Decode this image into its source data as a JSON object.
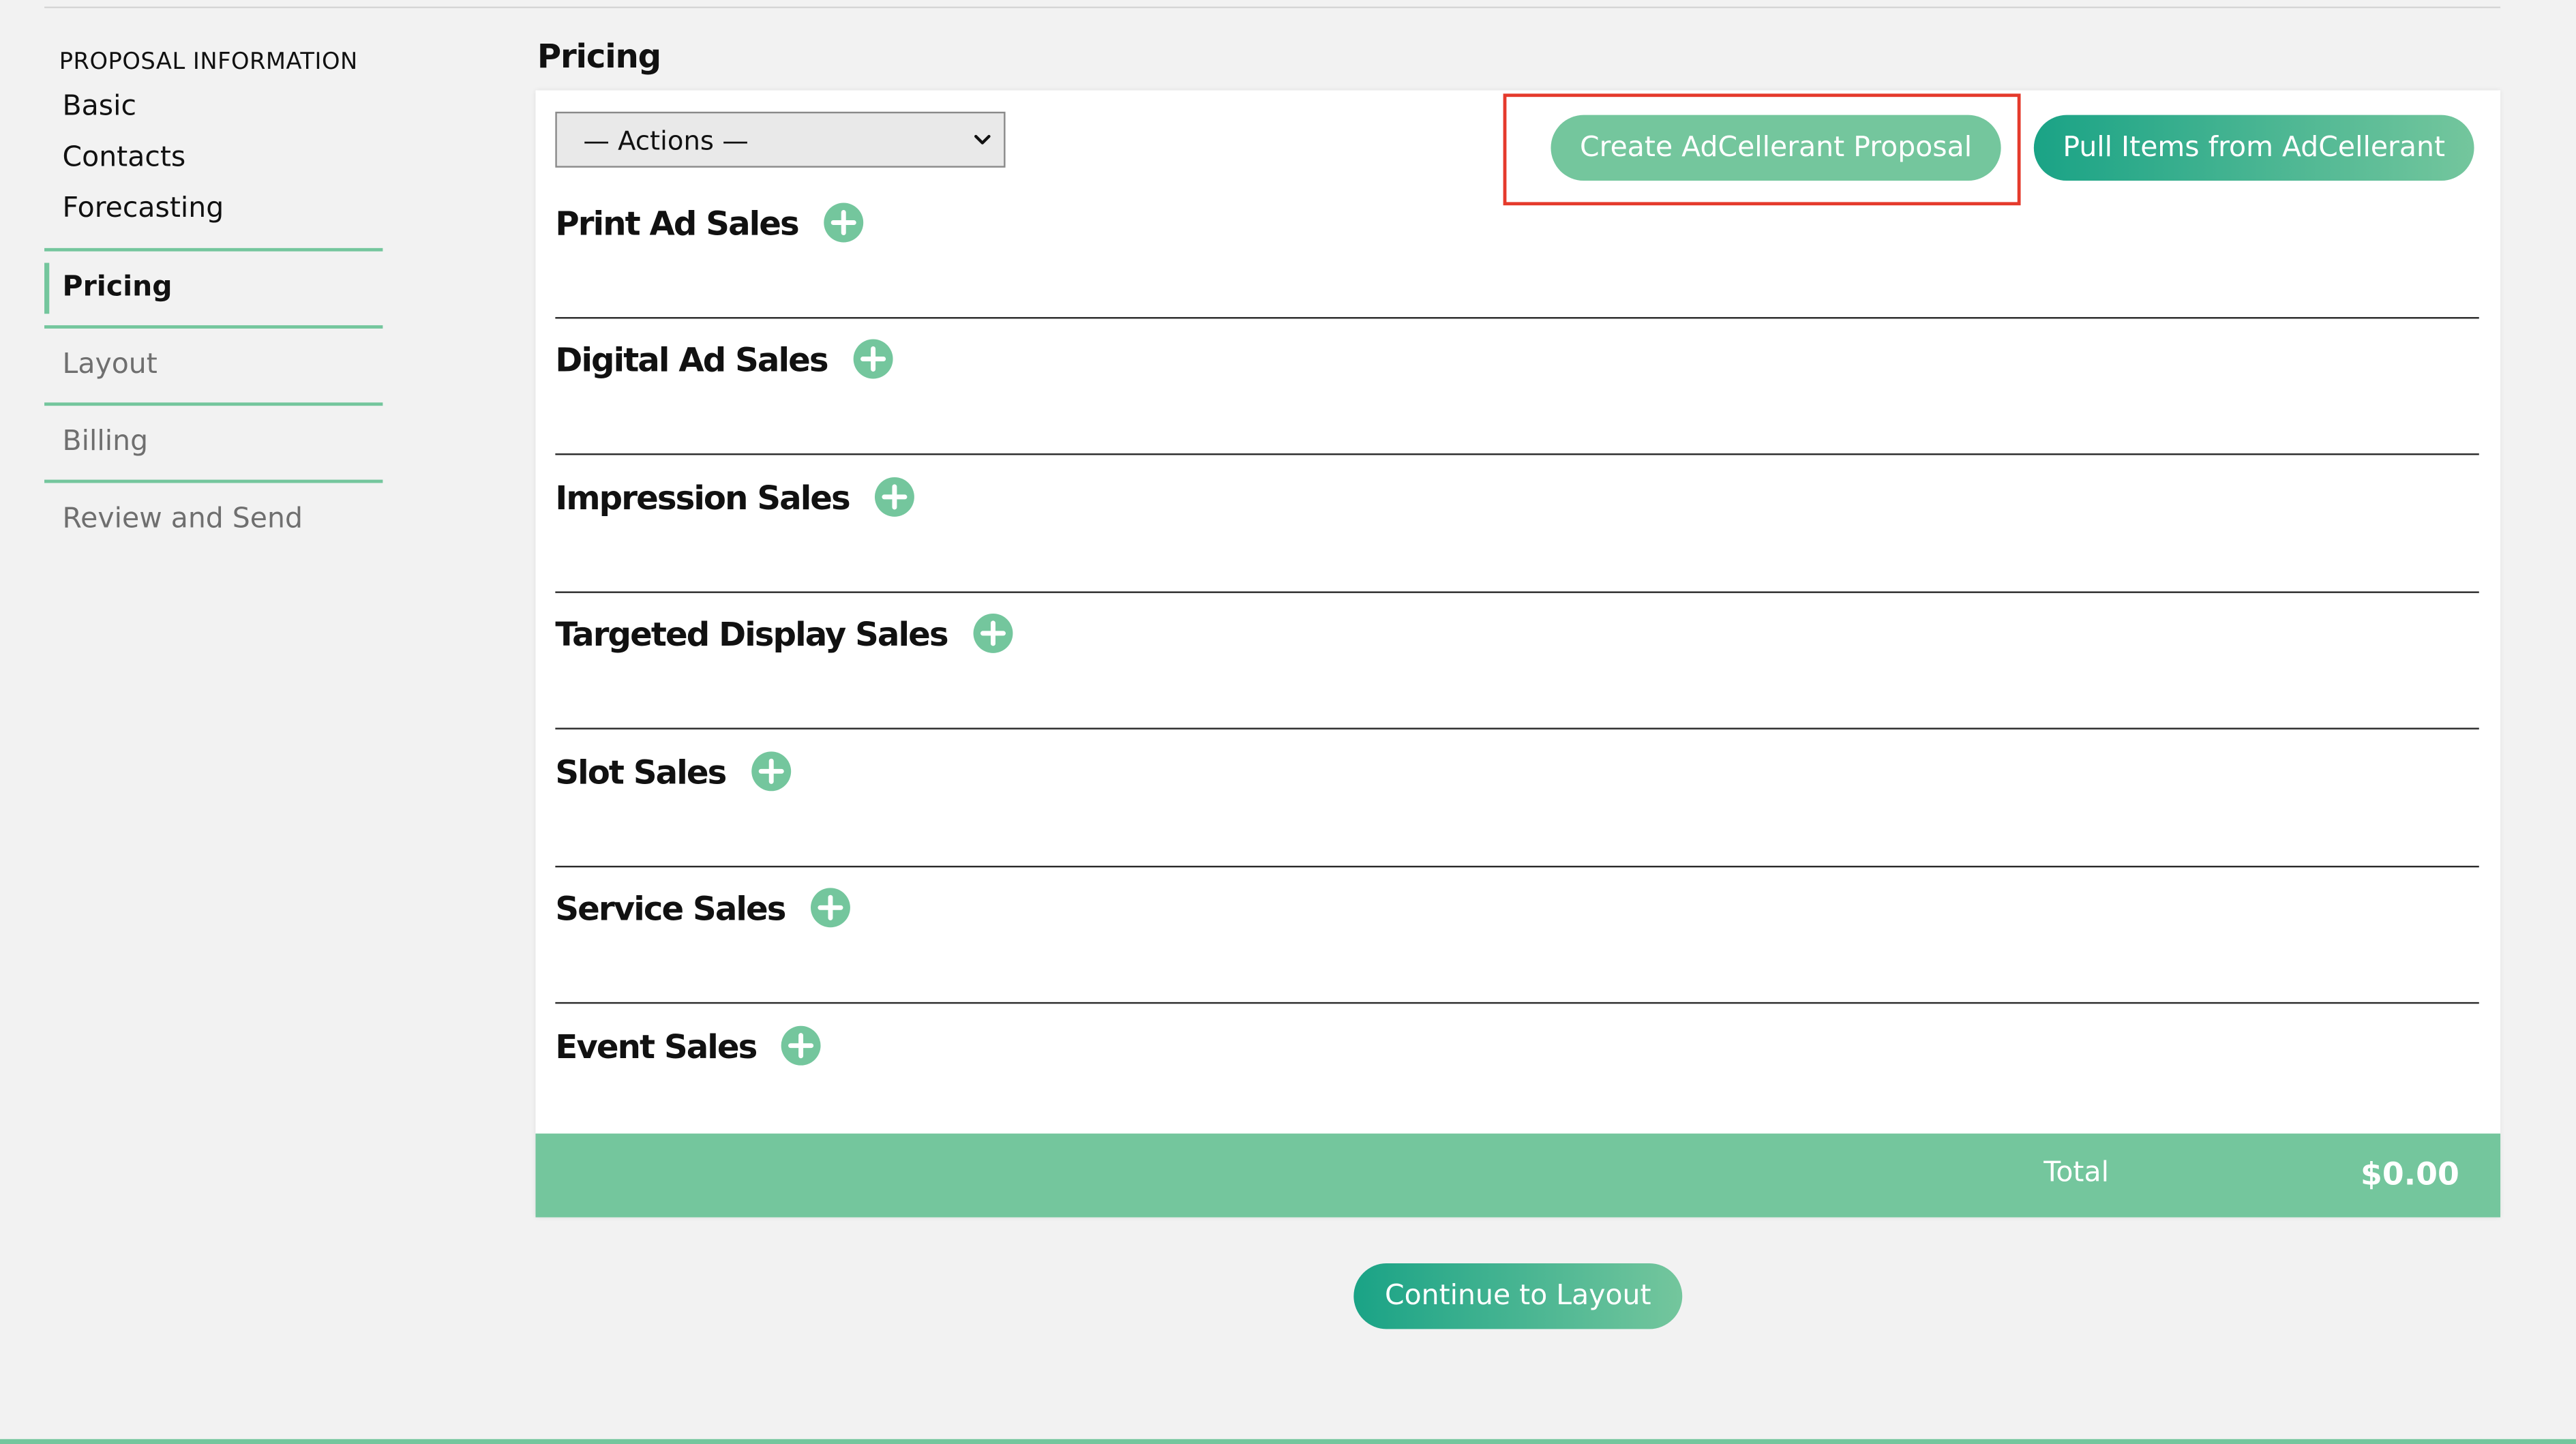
{
  "sidebar": {
    "header": "PROPOSAL INFORMATION",
    "sub_items": [
      "Basic",
      "Contacts",
      "Forecasting"
    ],
    "nav_items": [
      {
        "label": "Pricing",
        "active": true
      },
      {
        "label": "Layout",
        "active": false
      },
      {
        "label": "Billing",
        "active": false
      },
      {
        "label": "Review and Send",
        "active": false
      }
    ]
  },
  "main": {
    "title": "Pricing",
    "actions_select": {
      "selected": "— Actions —"
    },
    "create_button": "Create AdCellerant Proposal",
    "pull_button": "Pull Items from AdCellerant",
    "sections": [
      "Print Ad Sales",
      "Digital Ad Sales",
      "Impression Sales",
      "Targeted Display Sales",
      "Slot Sales",
      "Service Sales",
      "Event Sales"
    ],
    "total_label": "Total",
    "total_value": "$0.00",
    "continue_button": "Continue to Layout"
  },
  "colors": {
    "accent": "#74c69d",
    "accent_dark": "#1aa386",
    "highlight": "#e53a2c"
  },
  "icons": {
    "add": "plus-circle-icon",
    "dropdown": "chevron-down-icon"
  }
}
